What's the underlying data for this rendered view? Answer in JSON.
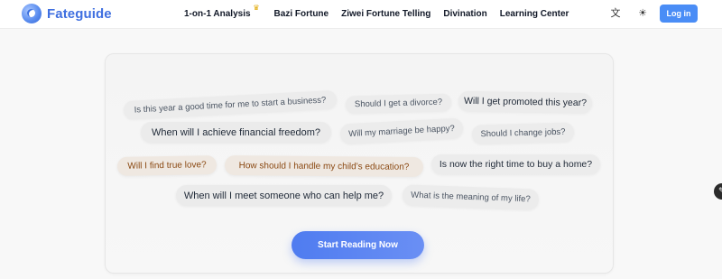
{
  "brand": {
    "name": "Fateguide"
  },
  "nav": {
    "items": [
      {
        "label": "1-on-1 Analysis",
        "badge_icon": "crown-icon"
      },
      {
        "label": "Bazi Fortune"
      },
      {
        "label": "Ziwei Fortune Telling"
      },
      {
        "label": "Divination"
      },
      {
        "label": "Learning Center"
      }
    ],
    "login_label": "Log in",
    "language_icon": "translate-icon",
    "theme_icon": "sun-icon"
  },
  "questions": [
    "Is this year a good time for me to start a business?",
    "Should I get a divorce?",
    "Will I get promoted this year?",
    "When will I achieve financial freedom?",
    "Will my marriage be happy?",
    "Should I change jobs?",
    "Will I find true love?",
    "How should I handle my child's education?",
    "Is now the right time to buy a home?",
    "When will I meet someone who can help me?",
    "What is the meaning of my life?"
  ],
  "cta": {
    "label": "Start Reading Now"
  },
  "colors": {
    "accent": "#4a8df6",
    "brand": "#3f6fe0",
    "cta": "#5b84f2"
  }
}
